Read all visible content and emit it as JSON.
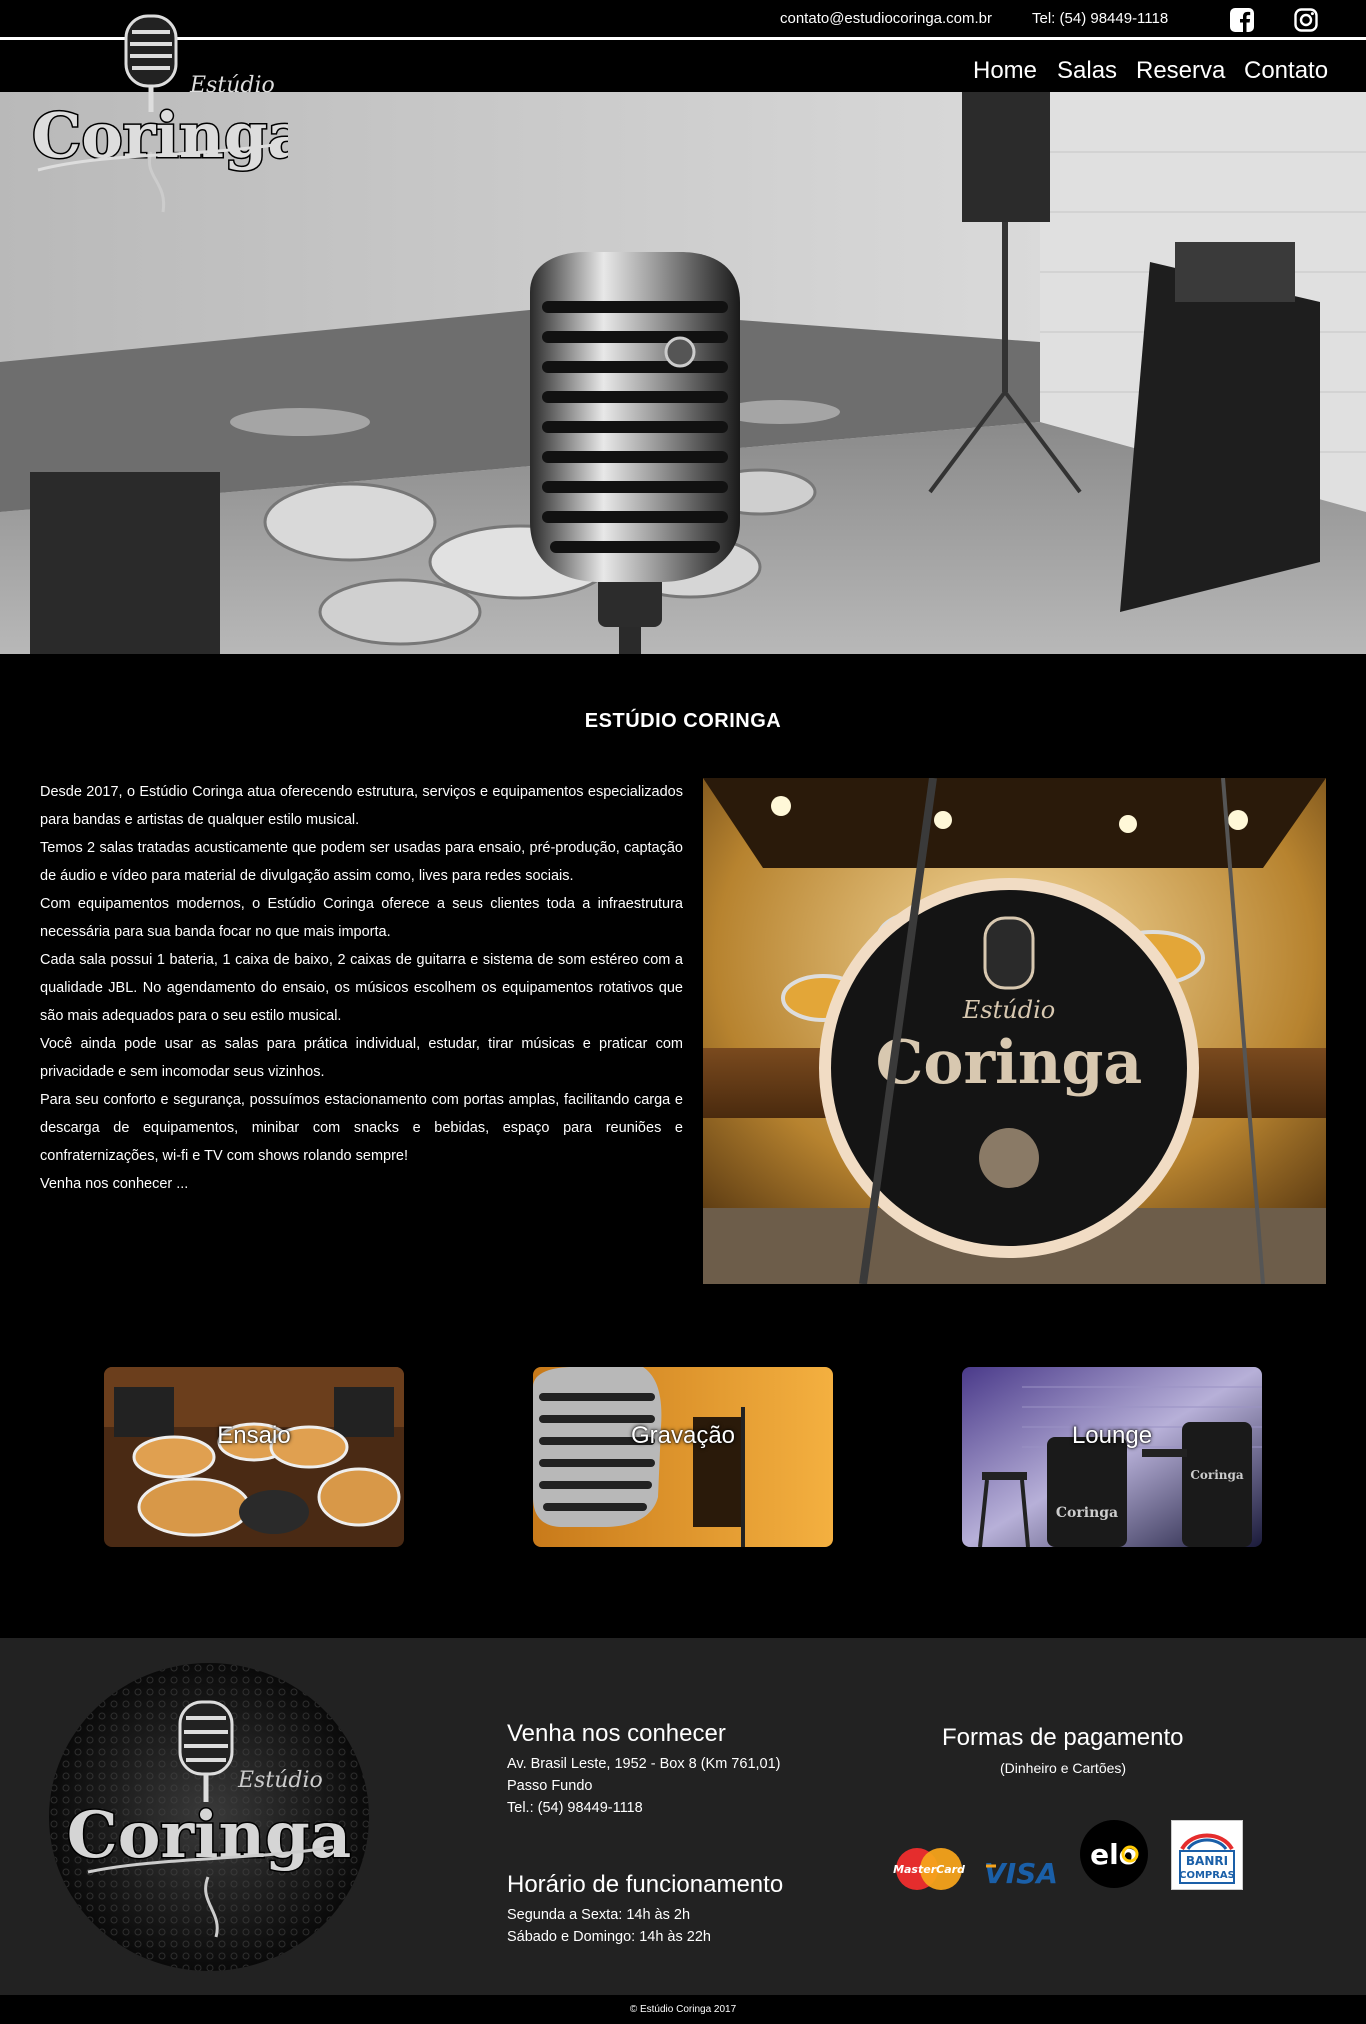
{
  "topbar": {
    "email": "contato@estudiocoringa.com.br",
    "phone": "Tel: (54) 98449-1118",
    "facebook_icon": "facebook-icon",
    "instagram_icon": "instagram-icon"
  },
  "nav": {
    "items": [
      "Home",
      "Salas",
      "Reserva",
      "Contato"
    ]
  },
  "logo": {
    "script": "Estúdio",
    "name": "Coringa"
  },
  "about": {
    "title": "ESTÚDIO CORINGA",
    "paragraphs": [
      "Desde 2017, o Estúdio Coringa atua oferecendo estrutura, serviços e equipamentos especializados para bandas e artistas de qualquer estilo musical.",
      "Temos 2 salas tratadas acusticamente que podem ser usadas para ensaio, pré-produção, captação de áudio e vídeo para material de divulgação assim como, lives para redes sociais.",
      "Com equipamentos modernos, o Estúdio Coringa oferece a seus clientes toda a infraestrutura necessária para sua banda focar no que mais importa.",
      "Cada sala possui 1 bateria, 1 caixa de baixo, 2 caixas de guitarra e sistema de som estéreo com a qualidade JBL. No agendamento do ensaio, os músicos escolhem os equipamentos rotativos que são mais adequados para o seu estilo musical.",
      "Você ainda pode usar as salas para prática individual, estudar, tirar músicas e praticar com privacidade e sem incomodar seus vizinhos.",
      "Para seu conforto e segurança, possuímos estacionamento com portas amplas, facilitando carga e descarga de equipamentos, minibar com snacks e bebidas, espaço para reuniões e confraternizações, wi-fi e TV com shows rolando sempre!",
      "Venha nos conhecer ..."
    ]
  },
  "cards": [
    {
      "label": "Ensaio"
    },
    {
      "label": "Gravação"
    },
    {
      "label": "Lounge"
    }
  ],
  "footer": {
    "visit_title": "Venha nos conhecer",
    "address_line1": "Av. Brasil Leste, 1952 - Box 8 (Km 761,01)",
    "address_line2": "Passo Fundo",
    "address_phone": "Tel.: (54) 98449-1118",
    "hours_title": "Horário de funcionamento",
    "hours_weekday": "Segunda a Sexta: 14h às 2h",
    "hours_weekend": "Sábado e Domingo: 14h às 22h",
    "payment_title": "Formas de pagamento",
    "payment_subtitle": "(Dinheiro e Cartões)",
    "payment_methods": {
      "mastercard": "MasterCard",
      "visa": "VISA",
      "elo": "elo",
      "banri_top": "BANRI",
      "banri_bottom": "COMPRAS"
    }
  },
  "copyright": "© Estúdio Coringa 2017",
  "colors": {
    "background": "#000000",
    "footer": "#222222",
    "text": "#ffffff",
    "visa_blue": "#1a5fa8",
    "mastercard_red": "#e52d2d",
    "mastercard_orange": "#f6a31b"
  }
}
